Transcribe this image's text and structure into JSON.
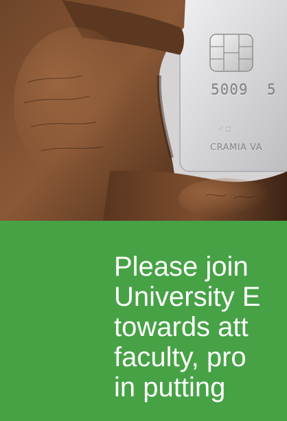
{
  "hero": {
    "card": {
      "digits_left": "5009",
      "digits_right": "5",
      "small_text": "⁄ ⬚",
      "name_text": "CRAMIA VA"
    }
  },
  "banner": {
    "lines": [
      "Please join",
      "University E",
      "towards att",
      "faculty, pro",
      "in putting"
    ]
  },
  "colors": {
    "banner_green": "#47a246",
    "banner_text": "#ffffff"
  }
}
